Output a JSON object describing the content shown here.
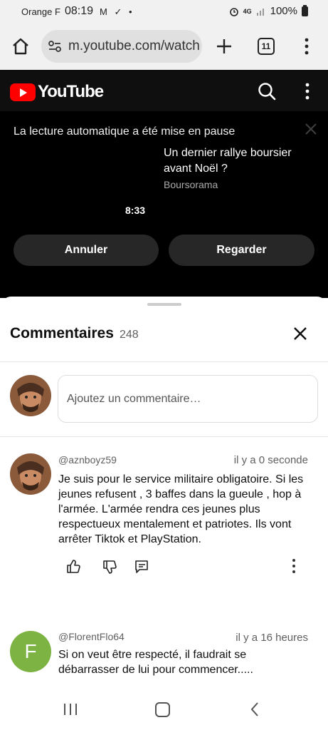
{
  "status": {
    "carrier": "Orange F",
    "time": "08:19",
    "notif_icons": "M ✓ •",
    "battery": "100%",
    "icon_names": [
      "gmail-icon",
      "download-done-icon",
      "alarm-icon",
      "4g-icon",
      "signal-icon",
      "battery-icon"
    ]
  },
  "browser": {
    "url": "m.youtube.com/watch",
    "tab_count": "11"
  },
  "youtube": {
    "brand": "YouTube"
  },
  "player": {
    "autoplay_message": "La lecture automatique a été mise en pause",
    "next_title": "Un dernier rallye boursier avant Noël ?",
    "next_channel": "Boursorama",
    "duration": "8:33",
    "cancel_label": "Annuler",
    "watch_label": "Regarder"
  },
  "comments": {
    "title": "Commentaires",
    "count": "248",
    "add_placeholder": "Ajoutez un commentaire…",
    "items": [
      {
        "author": "@aznboyz59",
        "time": "il y a 0 seconde",
        "text": "Je suis pour le service militaire obligatoire.  Si les jeunes refusent , 3 baffes dans la gueule , hop à l'armée.  L'armée rendra ces jeunes plus respectueux mentalement et patriotes.  Ils vont arrêter Tiktok et PlayStation."
      },
      {
        "author": "@FlorentFlo64",
        "avatar_letter": "F",
        "time": "il y a 16 heures",
        "text": "Si on veut être respecté, il faudrait se débarrasser de lui pour commencer....."
      }
    ]
  },
  "colors": {
    "youtube_red": "#ff0000",
    "dark_bg": "#0f0f0f",
    "pill_bg": "#272727",
    "avatar_green": "#7cb342"
  }
}
